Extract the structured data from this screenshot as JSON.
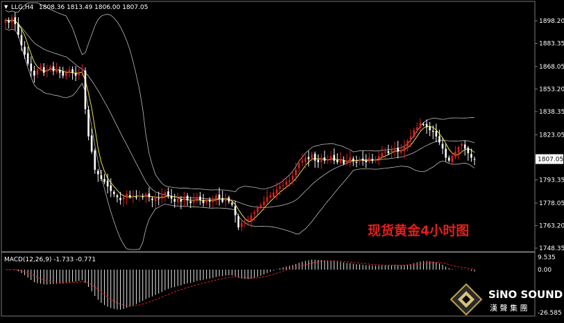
{
  "header": {
    "symbol_label": "LLG,H4",
    "ohlc_text": "1808.36 1813.49 1806.00 1807.05",
    "dropdown_glyph": "▼"
  },
  "annotation": {
    "text": "现货黄金4小时图"
  },
  "macd": {
    "label": "MACD(12,26,9) -1.733 -0.771"
  },
  "watermark": {
    "brand_text": "SiNO SOUND",
    "brand_sub": "漢 聲 集 團",
    "logo_icon": "diamond-logo-icon"
  },
  "colors": {
    "background": "#000000",
    "up_candle": "#e02020",
    "down_candle": "#ffffff",
    "ma_line": "#e8e83a",
    "band_line": "#bdbdbd",
    "axis_text": "#ffffff",
    "annotation_text": "#e0201c",
    "macd_histogram": "#ffffff",
    "macd_signal": "#e02020"
  },
  "chart_data": [
    {
      "type": "candlestick",
      "symbol": "LLG",
      "timeframe": "H4",
      "title": "",
      "ylim": [
        1748.35,
        1906
      ],
      "y_ticks": [
        "1898.20",
        "1883.35",
        "1868.05",
        "1853.20",
        "1838.35",
        "1823.05",
        "1807.05",
        "1793.35",
        "1778.05",
        "1763.20",
        "1748.35"
      ],
      "current_price": 1807.05,
      "closes": [
        1899,
        1897,
        1900,
        1896,
        1889,
        1882,
        1876,
        1870,
        1865,
        1862,
        1866,
        1868,
        1864,
        1866,
        1868,
        1865,
        1866,
        1864,
        1862,
        1864,
        1866,
        1864,
        1862,
        1864,
        1865,
        1840,
        1822,
        1812,
        1800,
        1797,
        1794,
        1792,
        1789,
        1786,
        1784,
        1782,
        1780,
        1782,
        1784,
        1782,
        1783,
        1782,
        1783,
        1782,
        1784,
        1782,
        1780,
        1782,
        1781,
        1783,
        1785,
        1783,
        1781,
        1779,
        1781,
        1779,
        1782,
        1780,
        1778,
        1780,
        1782,
        1780,
        1778,
        1780,
        1779,
        1781,
        1783,
        1781,
        1779,
        1781,
        1779,
        1777,
        1770,
        1762,
        1765,
        1766,
        1767,
        1770,
        1772,
        1775,
        1777,
        1779,
        1782,
        1783,
        1785,
        1787,
        1789,
        1790,
        1792,
        1793,
        1796,
        1800,
        1804,
        1806,
        1808,
        1807,
        1810,
        1806,
        1805,
        1808,
        1806,
        1807,
        1809,
        1806,
        1805,
        1807,
        1804,
        1806,
        1808,
        1806,
        1805,
        1807,
        1806,
        1805,
        1808,
        1806,
        1807,
        1809,
        1811,
        1812,
        1811,
        1813,
        1814,
        1812,
        1813,
        1815,
        1819,
        1822,
        1826,
        1828,
        1831,
        1830,
        1828,
        1826,
        1825,
        1822,
        1818,
        1814,
        1808,
        1806,
        1809,
        1812,
        1815,
        1817,
        1814,
        1811,
        1808,
        1807
      ],
      "overlays": [
        "moving-average",
        "bollinger-bands"
      ]
    },
    {
      "type": "macd",
      "params": "12,26,9",
      "main": -1.733,
      "signal": -0.771,
      "ylim": [
        -26.585,
        9.535
      ],
      "y_ticks": [
        "9.535",
        "0.00",
        "-26.585"
      ]
    }
  ]
}
